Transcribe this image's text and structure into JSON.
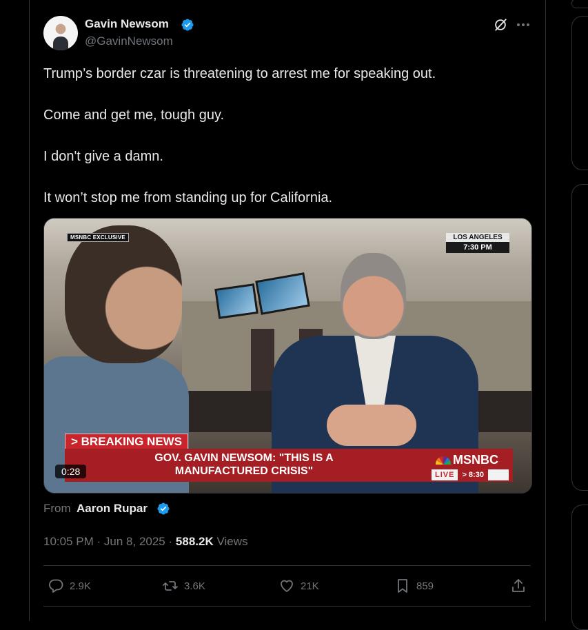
{
  "author": {
    "display_name": "Gavin Newsom",
    "handle": "@GavinNewsom",
    "verified": true
  },
  "tweet": {
    "paragraphs": [
      "Trump’s border czar is threatening to arrest me for speaking out.",
      "Come and get me, tough guy.",
      "I don't give a damn.",
      "It won’t stop me from standing up for California."
    ]
  },
  "video": {
    "exclusive_tag": "MSNBC EXCLUSIVE",
    "location": "LOS ANGELES",
    "time": "7:30 PM",
    "breaking": "> BREAKING NEWS",
    "headline_line1": "GOV. GAVIN NEWSOM: \"THIS IS A",
    "headline_line2": "MANUFACTURED CRISIS\"",
    "network": "MSNBC",
    "live_label": "LIVE",
    "next_label": "> 8:30",
    "duration": "0:28"
  },
  "attribution": {
    "from_label": "From",
    "source_name": "Aaron Rupar"
  },
  "meta": {
    "time": "10:05 PM",
    "date": "Jun 8, 2025",
    "separator": "·",
    "views_count": "588.2K",
    "views_label": "Views"
  },
  "actions": {
    "replies": "2.9K",
    "reposts": "3.6K",
    "likes": "21K",
    "bookmarks": "859"
  },
  "colors": {
    "background": "#000000",
    "text": "#e7e9ea",
    "muted": "#71767b",
    "border": "#2f3336",
    "verified_blue": "#1d9bf0"
  }
}
